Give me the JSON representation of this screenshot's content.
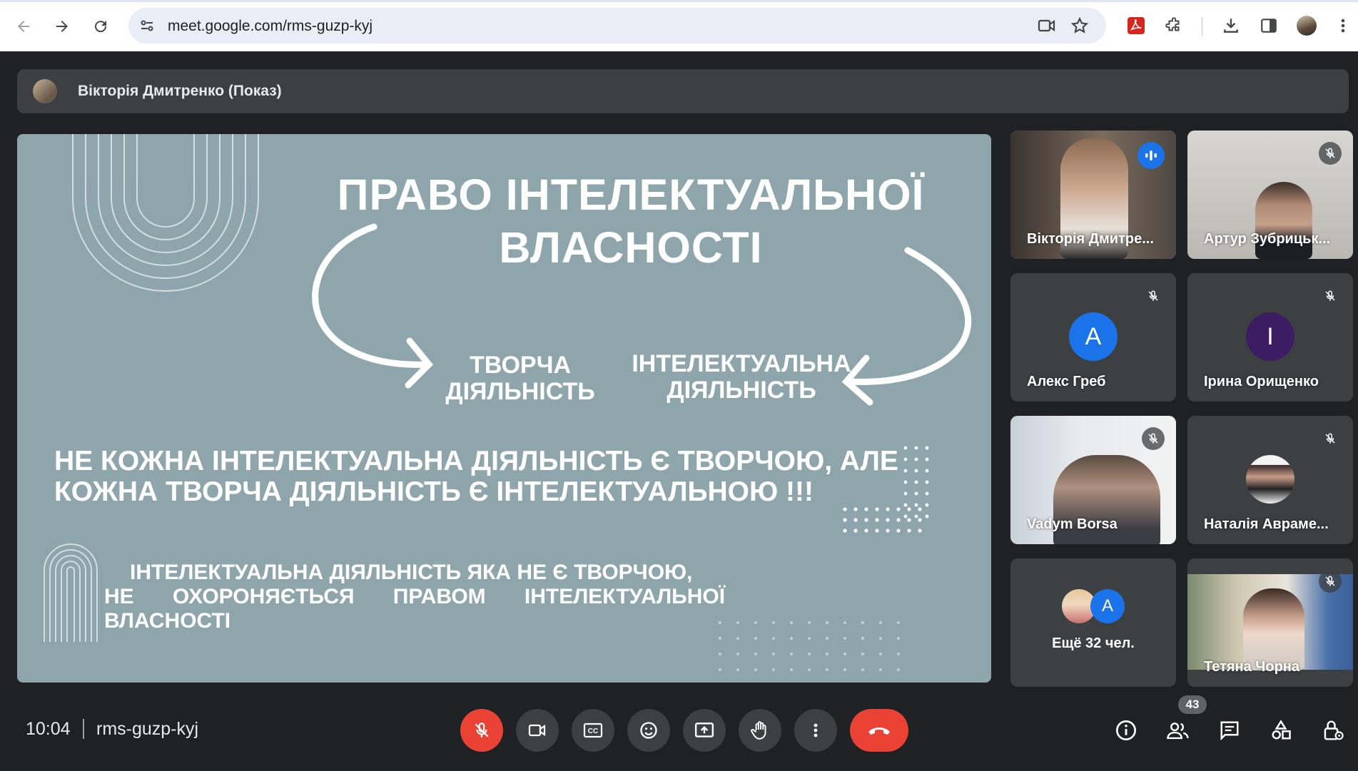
{
  "browser": {
    "url": "meet.google.com/rms-guzp-kyj",
    "nav": {
      "back_icon": "arrow-back-icon",
      "forward_icon": "arrow-forward-icon",
      "reload_icon": "reload-icon"
    },
    "toolbar_icons": [
      "pdf-extension-icon",
      "extensions-puzzle-icon",
      "download-icon",
      "side-panel-icon",
      "profile-avatar",
      "more-vert-icon"
    ]
  },
  "presenter": {
    "title": "Вікторія Дмитренко (Показ)"
  },
  "slide": {
    "title_line1": "ПРАВО ІНТЕЛЕКТУАЛЬНОЇ",
    "title_line2": "ВЛАСНОСТІ",
    "left_label_line1": "ТВОРЧА",
    "left_label_line2": "ДІЯЛЬНІСТЬ",
    "right_label_line1": "ІНТЕЛЕКТУАЛЬНА",
    "right_label_line2": "ДІЯЛЬНІСТЬ",
    "statement_line1": "НЕ КОЖНА ІНТЕЛЕКТУАЛЬНА ДІЯЛЬНІСТЬ Є ТВОРЧОЮ, АЛЕ",
    "statement_line2": "КОЖНА ТВОРЧА ДІЯЛЬНІСТЬ Є ІНТЕЛЕКТУАЛЬНОЮ !!!",
    "bottom_line1": "ІНТЕЛЕКТУАЛЬНА ДІЯЛЬНІСТЬ ЯКА НЕ Є ТВОРЧОЮ,",
    "bottom_line2": "НЕ ОХОРОНЯЄТЬСЯ ПРАВОМ ІНТЕЛЕКТУАЛЬНОЇ",
    "bottom_line3": "ВЛАСНОСТІ",
    "background_color": "#8ea6ab"
  },
  "participants": [
    {
      "name": "Вікторія Дмитре...",
      "state": "speaking",
      "type": "video"
    },
    {
      "name": "Артур Зубрицьк...",
      "state": "muted",
      "type": "video"
    },
    {
      "name": "Алекс Греб",
      "state": "muted",
      "type": "avatar",
      "initial": "A",
      "avatar_color": "#1a73e8"
    },
    {
      "name": "Ірина Орищенко",
      "state": "muted",
      "type": "avatar",
      "initial": "I",
      "avatar_color": "#3c1d64"
    },
    {
      "name": "Vadym Borsa",
      "state": "muted",
      "type": "video"
    },
    {
      "name": "Наталія Авраме...",
      "state": "muted",
      "type": "photo"
    },
    {
      "name": "Ещё 32 чел.",
      "type": "overflow",
      "initial": "A"
    },
    {
      "name": "Тетяна Чорна",
      "state": "muted",
      "type": "video"
    }
  ],
  "bottom_bar": {
    "time": "10:04",
    "meeting_code": "rms-guzp-kyj",
    "participant_count": "43",
    "controls": [
      "mic-off-icon",
      "camera-icon",
      "captions-icon",
      "emoji-icon",
      "present-screen-icon",
      "raise-hand-icon",
      "more-options-icon",
      "hang-up-icon"
    ],
    "right_controls": [
      "info-icon",
      "people-icon",
      "chat-icon",
      "activities-icon",
      "host-controls-icon"
    ]
  },
  "colors": {
    "meet_bg": "#202124",
    "tile_bg": "#3c4043",
    "mic_off_red": "#ea4335",
    "active_speaker_outline": "#8ab4f8",
    "speaker_blue": "#1a73e8"
  }
}
